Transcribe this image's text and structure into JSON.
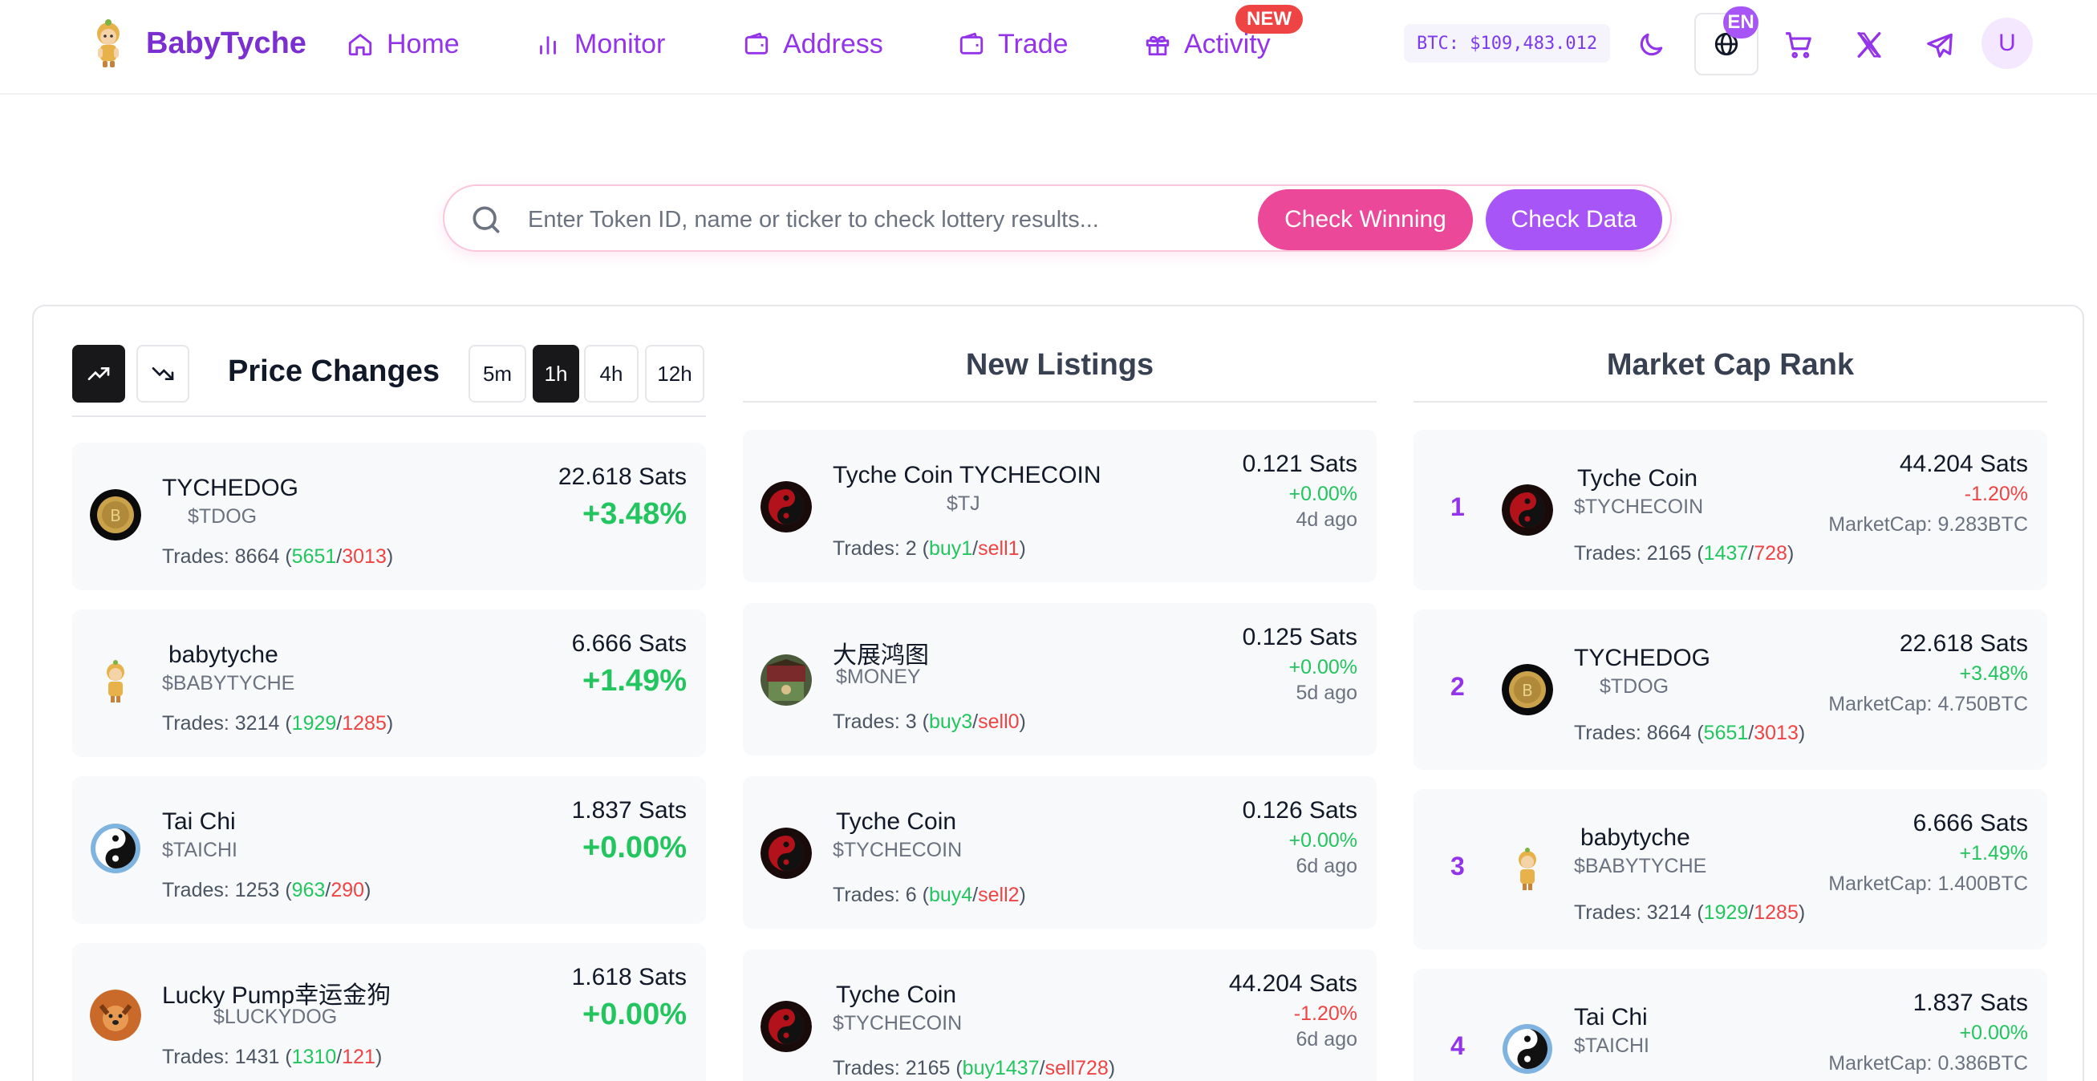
{
  "brand": {
    "name": "BabyTyche"
  },
  "nav": {
    "home": "Home",
    "monitor": "Monitor",
    "address": "Address",
    "trade": "Trade",
    "activity": "Activity",
    "new_badge": "NEW"
  },
  "header": {
    "btc_price": "BTC: $109,483.012",
    "lang": "EN",
    "avatar_initial": "U"
  },
  "search": {
    "placeholder": "Enter Token ID, name or ticker to check lottery results...",
    "check_winning": "Check Winning",
    "check_data": "Check Data"
  },
  "colors": {
    "accent": "#9333ea",
    "pink": "#ec4899",
    "up": "#22c55e",
    "down": "#ef4444"
  },
  "price_changes": {
    "title": "Price Changes",
    "timeframes": [
      "5m",
      "1h",
      "4h",
      "12h"
    ],
    "active_timeframe": "1h",
    "items": [
      {
        "name": "TYCHEDOG",
        "ticker": "$TDOG",
        "trades_label": "Trades: 8664 (",
        "buys": "5651",
        "sep": "/",
        "sells": "3013",
        "close": ")",
        "price": "22.618 Sats",
        "change": "+3.48%",
        "icon": "gold-coin-icon"
      },
      {
        "name": "babytyche",
        "ticker": "$BABYTYCHE",
        "trades_label": "Trades: 3214 (",
        "buys": "1929",
        "sep": "/",
        "sells": "1285",
        "close": ")",
        "price": "6.666 Sats",
        "change": "+1.49%",
        "icon": "babytyche-mascot-icon"
      },
      {
        "name": "Tai Chi",
        "ticker": "$TAICHI",
        "trades_label": "Trades: 1253 (",
        "buys": "963",
        "sep": "/",
        "sells": "290",
        "close": ")",
        "price": "1.837 Sats",
        "change": "+0.00%",
        "icon": "yin-yang-icon"
      },
      {
        "name": "Lucky Pump幸运金狗",
        "ticker": "$LUCKYDOG",
        "trades_label": "Trades: 1431 (",
        "buys": "1310",
        "sep": "/",
        "sells": "121",
        "close": ")",
        "price": "1.618 Sats",
        "change": "+0.00%",
        "icon": "dog-icon"
      }
    ]
  },
  "new_listings": {
    "title": "New Listings",
    "items": [
      {
        "name": "Tyche Coin TYCHECOIN",
        "ticker": "$TJ",
        "trades_label": "Trades: 2 (",
        "buys": "buy1",
        "sep": "/",
        "sells": "sell1",
        "close": ")",
        "price": "0.121 Sats",
        "change": "+0.00%",
        "ago": "4d ago",
        "icon": "tyche-coin-icon"
      },
      {
        "name": "大展鸿图",
        "ticker": "$MONEY",
        "trades_label": "Trades: 3 (",
        "buys": "buy3",
        "sep": "/",
        "sells": "sell0",
        "close": ")",
        "price": "0.125 Sats",
        "change": "+0.00%",
        "ago": "5d ago",
        "icon": "money-icon"
      },
      {
        "name": "Tyche Coin",
        "ticker": "$TYCHECOIN",
        "trades_label": "Trades: 6 (",
        "buys": "buy4",
        "sep": "/",
        "sells": "sell2",
        "close": ")",
        "price": "0.126 Sats",
        "change": "+0.00%",
        "ago": "6d ago",
        "icon": "tyche-coin-icon"
      },
      {
        "name": "Tyche Coin",
        "ticker": "$TYCHECOIN",
        "trades_label": "Trades: 2165 (",
        "buys": "buy1437",
        "sep": "/",
        "sells": "sell728",
        "close": ")",
        "price": "44.204 Sats",
        "change": "-1.20%",
        "ago": "6d ago",
        "icon": "tyche-coin-icon"
      }
    ]
  },
  "market_cap": {
    "title": "Market Cap Rank",
    "items": [
      {
        "rank": "1",
        "name": "Tyche Coin",
        "ticker": "$TYCHECOIN",
        "trades_label": "Trades: 2165 (",
        "buys": "1437",
        "sep": "/",
        "sells": "728",
        "close": ")",
        "price": "44.204 Sats",
        "change": "-1.20%",
        "mcap": "MarketCap: 9.283BTC",
        "icon": "tyche-coin-icon"
      },
      {
        "rank": "2",
        "name": "TYCHEDOG",
        "ticker": "$TDOG",
        "trades_label": "Trades: 8664 (",
        "buys": "5651",
        "sep": "/",
        "sells": "3013",
        "close": ")",
        "price": "22.618 Sats",
        "change": "+3.48%",
        "mcap": "MarketCap: 4.750BTC",
        "icon": "gold-coin-icon"
      },
      {
        "rank": "3",
        "name": "babytyche",
        "ticker": "$BABYTYCHE",
        "trades_label": "Trades: 3214 (",
        "buys": "1929",
        "sep": "/",
        "sells": "1285",
        "close": ")",
        "price": "6.666 Sats",
        "change": "+1.49%",
        "mcap": "MarketCap: 1.400BTC",
        "icon": "babytyche-mascot-icon"
      },
      {
        "rank": "4",
        "name": "Tai Chi",
        "ticker": "$TAICHI",
        "trades_label": "",
        "buys": "",
        "sep": "",
        "sells": "",
        "close": "",
        "price": "1.837 Sats",
        "change": "+0.00%",
        "mcap": "MarketCap: 0.386BTC",
        "icon": "yin-yang-icon"
      }
    ]
  }
}
